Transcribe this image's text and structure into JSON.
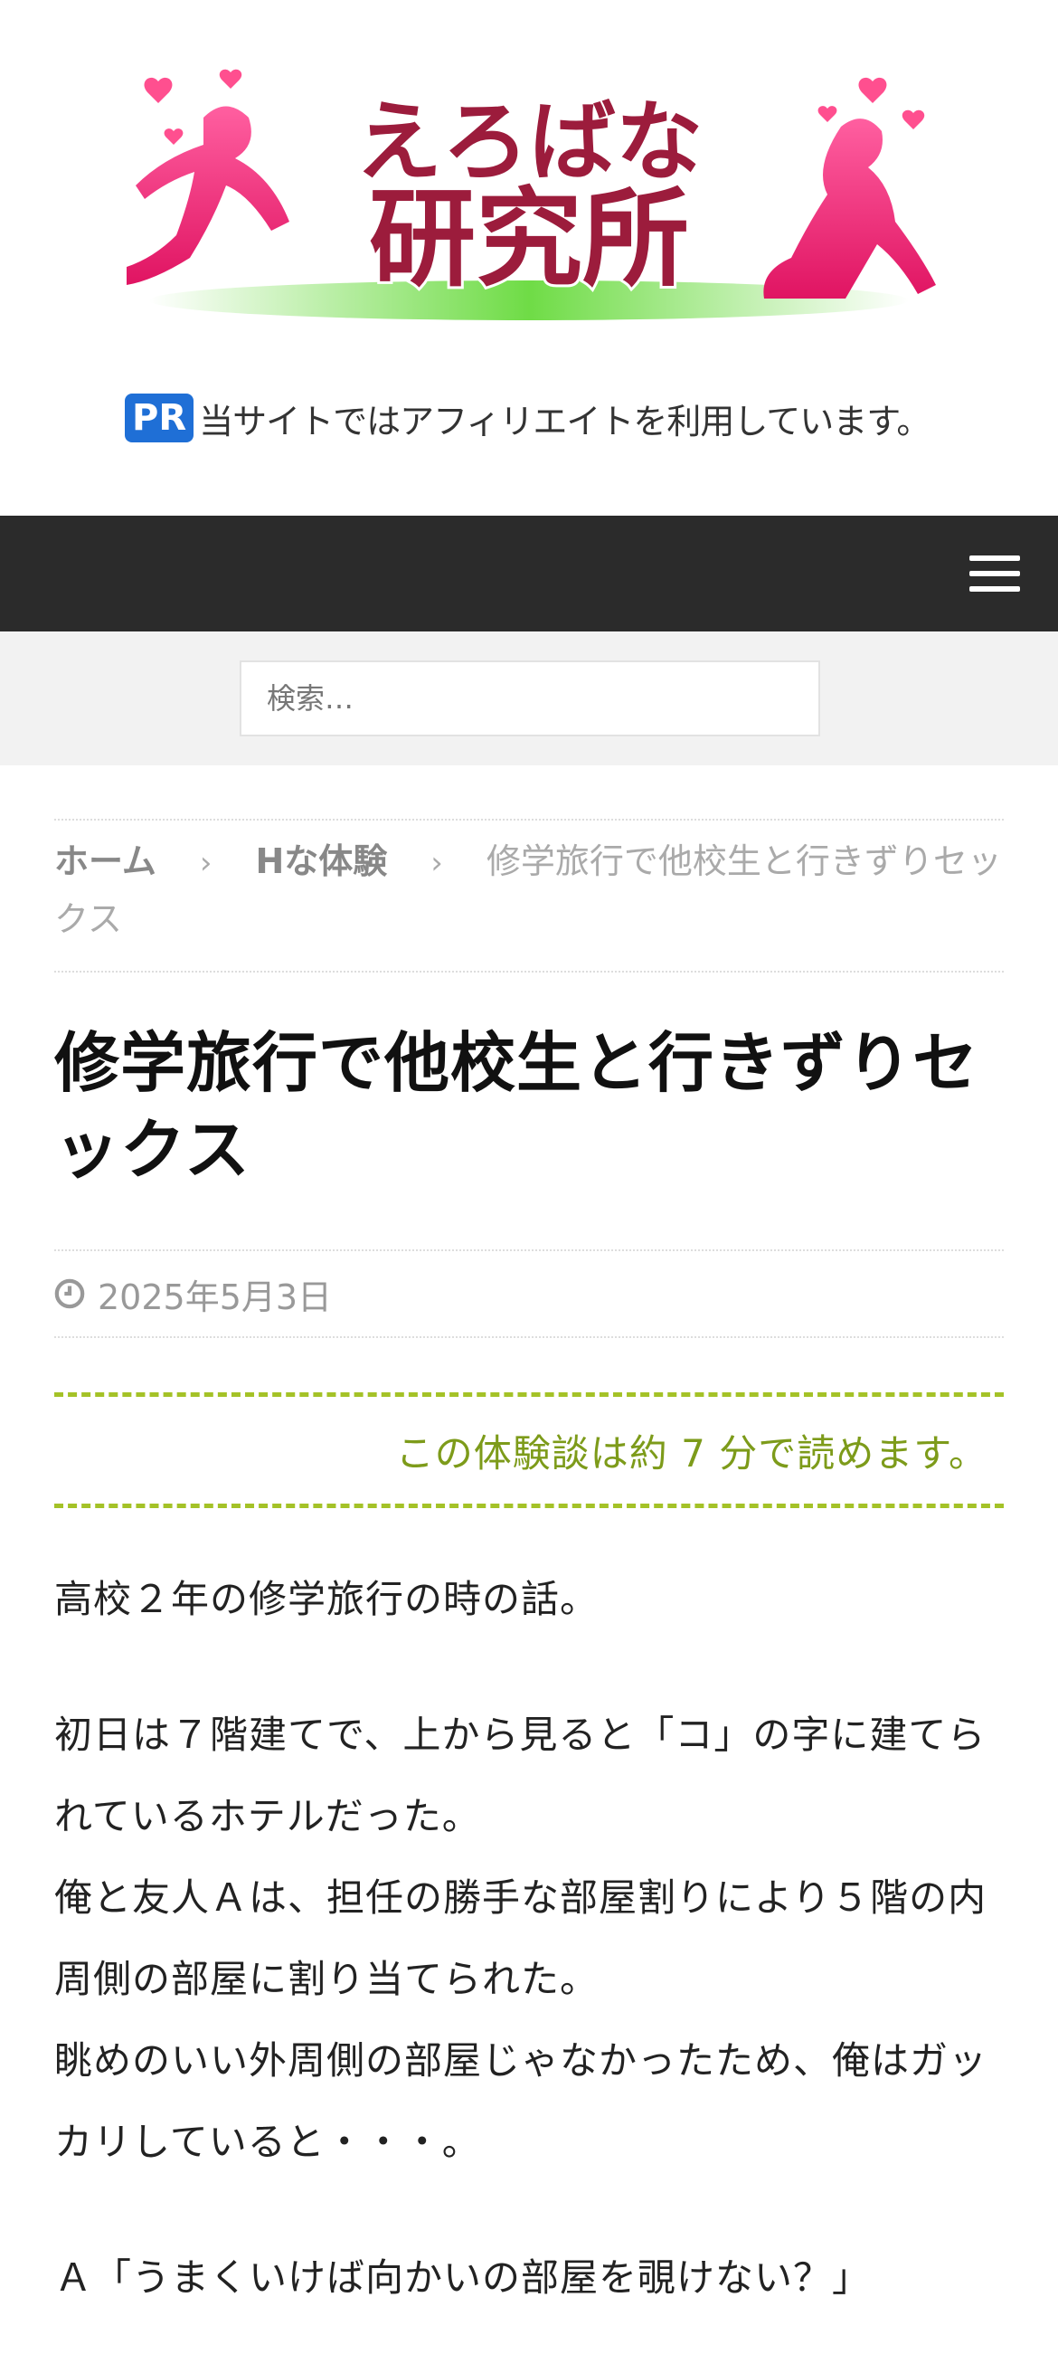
{
  "site": {
    "logo_text": "えろばな研究所",
    "pr_badge": "PR",
    "pr_notice": "当サイトではアフィリエイトを利用しています。"
  },
  "nav": {
    "menu_icon": "hamburger-menu-icon"
  },
  "search": {
    "placeholder": "検索…"
  },
  "breadcrumb": {
    "home": "ホーム",
    "category": "Hな体験",
    "current": "修学旅行で他校生と行きずりセックス",
    "separator": "›"
  },
  "article": {
    "title": "修学旅行で他校生と行きずりセックス",
    "date": "2025年5月3日",
    "read_time": "この体験談は約 7 分で読めます。",
    "paragraphs": [
      "高校２年の修学旅行の時の話。",
      "初日は７階建てで、上から見ると「コ」の字に建てられているホテルだった。\n俺と友人Ａは、担任の勝手な部屋割りにより５階の内周側の部屋に割り当てられた。\n眺めのいい外周側の部屋じゃなかったため、俺はガッカリしていると・・・。",
      "Ａ「うまくいけば向かいの部屋を覗けない？」"
    ]
  },
  "colors": {
    "navbar": "#2b2b2b",
    "accent_green": "#a4c227",
    "logo_pink": "#e8317a",
    "logo_maroon": "#9c1c3c"
  }
}
